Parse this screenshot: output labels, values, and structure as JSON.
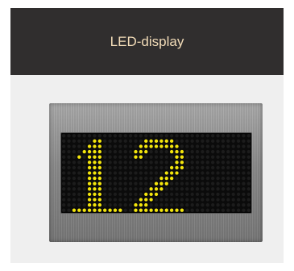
{
  "header": {
    "title": "LED-display"
  },
  "display": {
    "value": "12",
    "rows": 15,
    "cols": 37,
    "led_on_color": "#f4e60c",
    "led_off_color": "#1c1c1c"
  }
}
